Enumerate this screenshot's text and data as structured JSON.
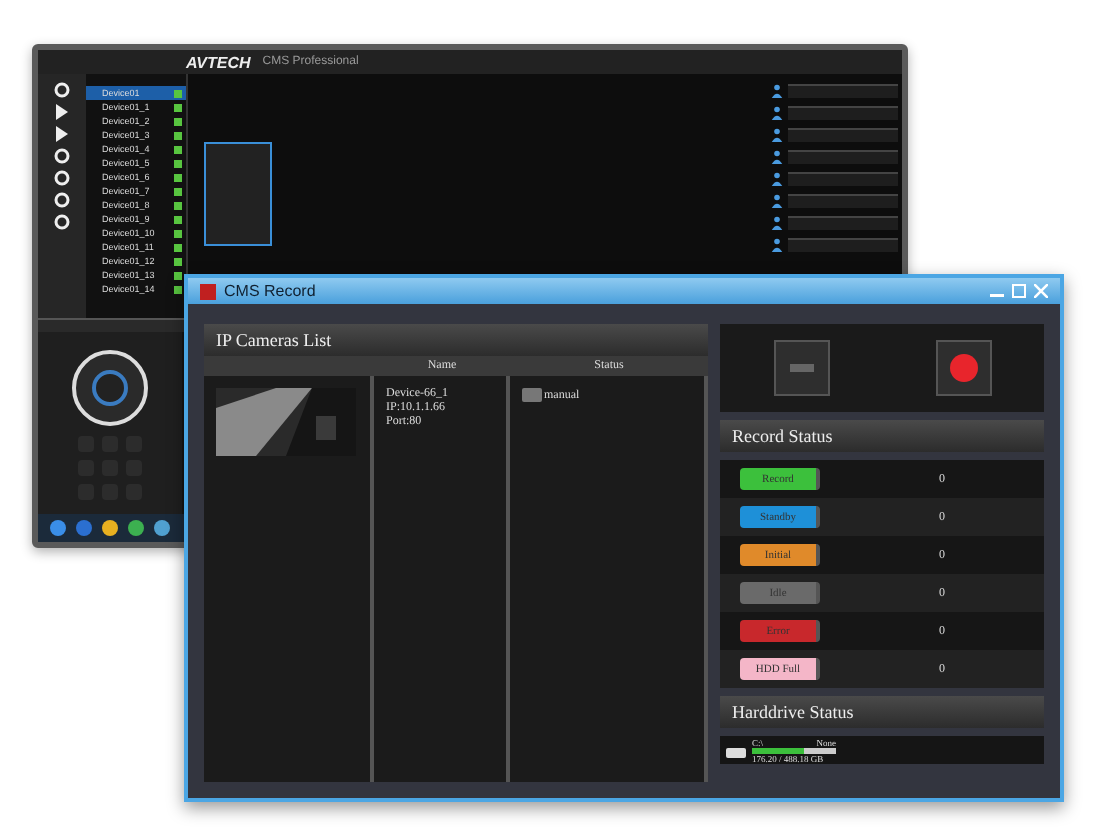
{
  "back_window": {
    "brand": "AVTECH",
    "product": "CMS Professional",
    "devices": [
      {
        "name": "Device01",
        "selected": true
      },
      {
        "name": "Device01_1",
        "selected": false
      },
      {
        "name": "Device01_2",
        "selected": false
      },
      {
        "name": "Device01_3",
        "selected": false
      },
      {
        "name": "Device01_4",
        "selected": false
      },
      {
        "name": "Device01_5",
        "selected": false
      },
      {
        "name": "Device01_6",
        "selected": false
      },
      {
        "name": "Device01_7",
        "selected": false
      },
      {
        "name": "Device01_8",
        "selected": false
      },
      {
        "name": "Device01_9",
        "selected": false
      },
      {
        "name": "Device01_10",
        "selected": false
      },
      {
        "name": "Device01_11",
        "selected": false
      },
      {
        "name": "Device01_12",
        "selected": false
      },
      {
        "name": "Device01_13",
        "selected": false
      },
      {
        "name": "Device01_14",
        "selected": false
      }
    ]
  },
  "cms_record": {
    "title": "CMS Record",
    "camera_list": {
      "title": "IP Cameras List",
      "columns": [
        "Name",
        "Status"
      ],
      "rows": [
        {
          "name": "Device-66_1",
          "ip": "IP:10.1.1.66",
          "port": "Port:80",
          "status": "manual"
        }
      ]
    },
    "record_status": {
      "title": "Record Status",
      "rows": [
        {
          "label": "Record",
          "color": "#3cc03c",
          "count": "0"
        },
        {
          "label": "Standby",
          "color": "#1e90d8",
          "count": "0"
        },
        {
          "label": "Initial",
          "color": "#e08a2a",
          "count": "0"
        },
        {
          "label": "Idle",
          "color": "#6a6a6a",
          "count": "0"
        },
        {
          "label": "Error",
          "color": "#c8282c",
          "count": "0"
        },
        {
          "label": "HDD Full",
          "color": "#f4b6c8",
          "count": "0"
        }
      ]
    },
    "harddrive": {
      "title": "Harddrive Status",
      "drive": "C:\\",
      "mode": "None",
      "usage": "176.20 / 488.18 GB",
      "level": 0.62
    }
  }
}
